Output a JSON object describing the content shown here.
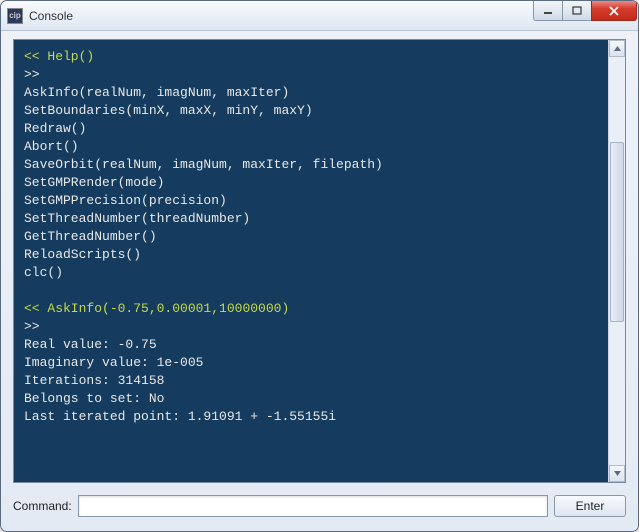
{
  "window": {
    "title": "Console",
    "icon_label": "cip"
  },
  "console": {
    "cmd1_prefix": "<< ",
    "cmd1": "Help()",
    "prompt": ">>",
    "help_lines": [
      "AskInfo(realNum, imagNum, maxIter)",
      "SetBoundaries(minX, maxX, minY, maxY)",
      "Redraw()",
      "Abort()",
      "SaveOrbit(realNum, imagNum, maxIter, filepath)",
      "SetGMPRender(mode)",
      "SetGMPPrecision(precision)",
      "SetThreadNumber(threadNumber)",
      "GetThreadNumber()",
      "ReloadScripts()",
      "clc()"
    ],
    "cmd2_prefix": "<< ",
    "cmd2": "AskInfo(-0.75,0.00001,10000000)",
    "result_lines": [
      "Real value: -0.75",
      "Imaginary value: 1e-005",
      "Iterations: 314158",
      "Belongs to set: No",
      "Last iterated point: 1.91091 + -1.55155i"
    ]
  },
  "command_bar": {
    "label": "Command:",
    "value": "",
    "enter_label": "Enter"
  }
}
